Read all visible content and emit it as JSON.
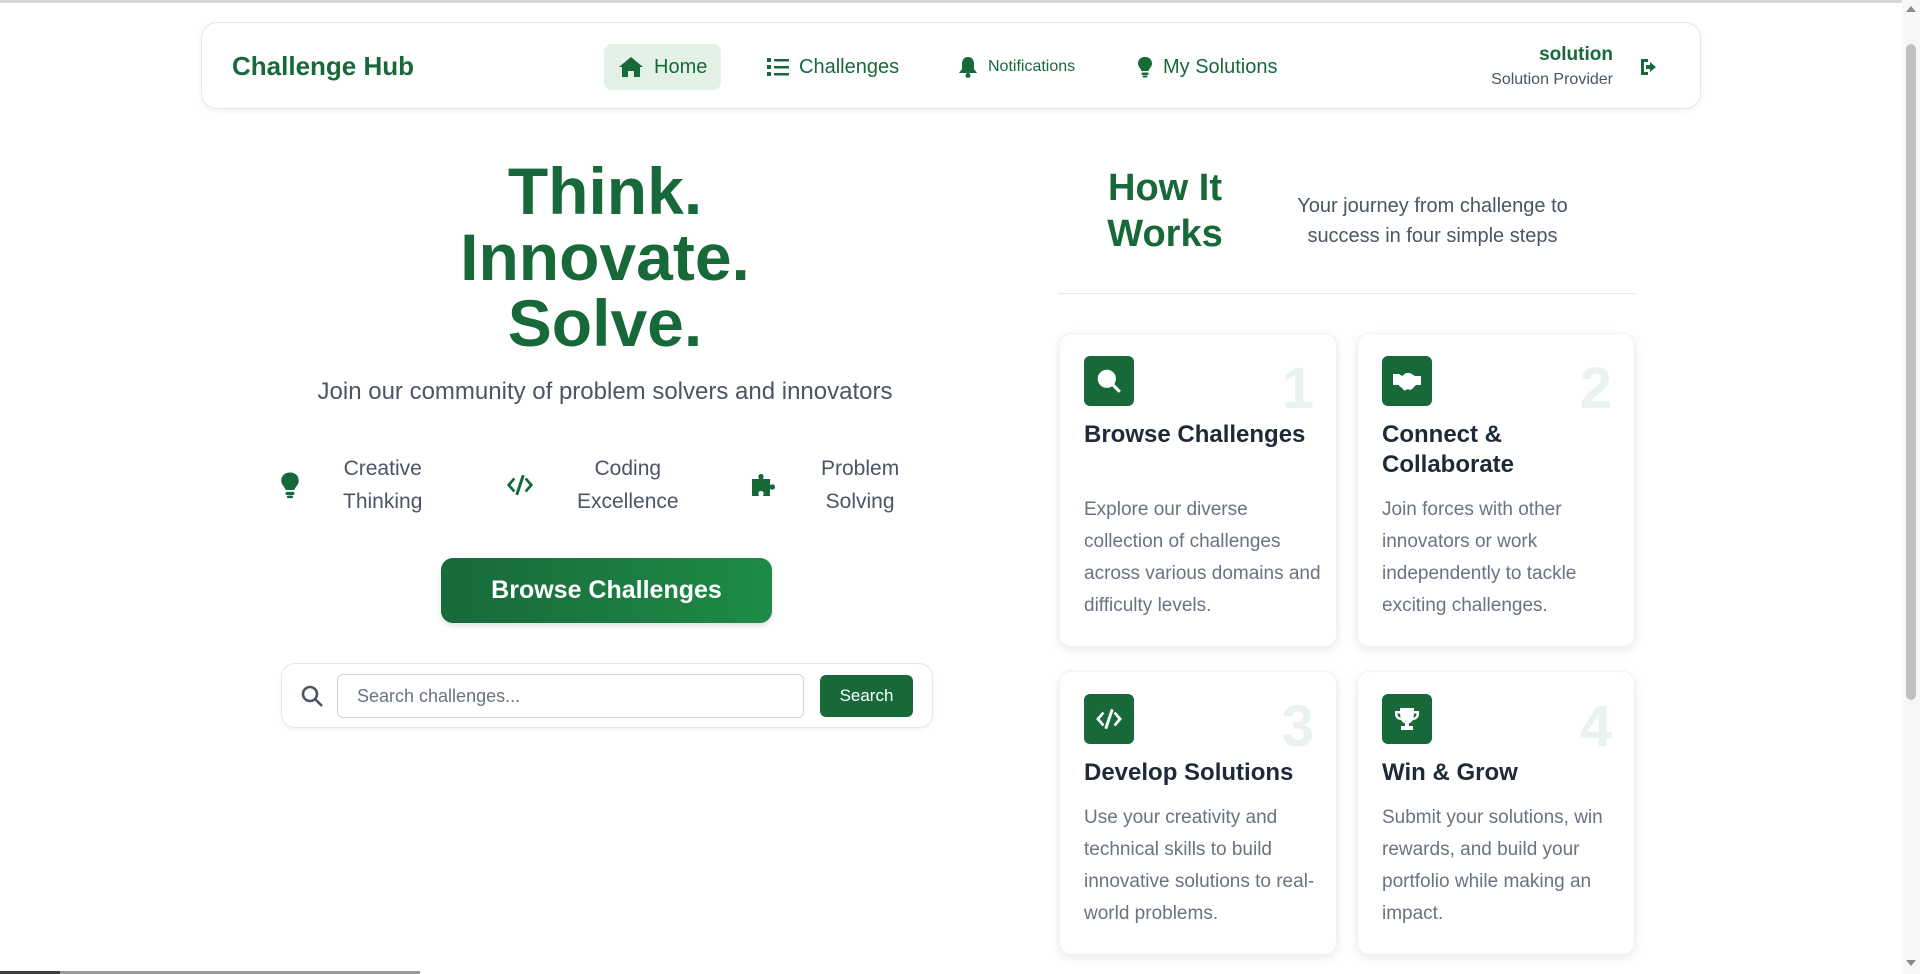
{
  "navbar": {
    "brand": "Challenge Hub",
    "items": [
      {
        "label": "Home",
        "icon": "home-icon",
        "active": true
      },
      {
        "label": "Challenges",
        "icon": "list-icon",
        "active": false
      },
      {
        "label": "Notifications",
        "icon": "bell-icon",
        "active": false
      },
      {
        "label": "My Solutions",
        "icon": "lightbulb-icon",
        "active": false
      }
    ],
    "user": {
      "name": "solution",
      "role": "Solution Provider"
    },
    "logout_icon": "logout-icon"
  },
  "hero": {
    "lines": [
      "Think.",
      "Innovate.",
      "Solve."
    ],
    "subtitle": "Join our community of problem solvers and innovators",
    "features": [
      {
        "icon": "lightbulb-icon",
        "line1": "Creative",
        "line2": "Thinking"
      },
      {
        "icon": "code-icon",
        "line1": "Coding",
        "line2": "Excellence"
      },
      {
        "icon": "puzzle-icon",
        "line1": "Problem",
        "line2": "Solving"
      }
    ],
    "cta": "Browse Challenges"
  },
  "search": {
    "placeholder": "Search challenges...",
    "value": "",
    "button": "Search"
  },
  "how": {
    "title_line1": "How It",
    "title_line2": "Works",
    "subtitle_line1": "Your journey from challenge to",
    "subtitle_line2": "success in four simple steps",
    "steps": [
      {
        "number": "1",
        "icon": "search-icon",
        "title": "Browse Challenges",
        "desc": "Explore our diverse collection of challenges across various domains and difficulty levels."
      },
      {
        "number": "2",
        "icon": "handshake-icon",
        "title": "Connect & Collaborate",
        "desc": "Join forces with other innovators or work independently to tackle exciting challenges."
      },
      {
        "number": "3",
        "icon": "code-icon",
        "title": "Develop Solutions",
        "desc": "Use your creativity and technical skills to build innovative solutions to real-world problems."
      },
      {
        "number": "4",
        "icon": "trophy-icon",
        "title": "Win & Grow",
        "desc": "Submit your solutions, win rewards, and build your portfolio while making an impact."
      }
    ]
  },
  "colors": {
    "primary": "#17693a",
    "active_bg": "#e3f1e7",
    "muted": "#6b7280"
  }
}
